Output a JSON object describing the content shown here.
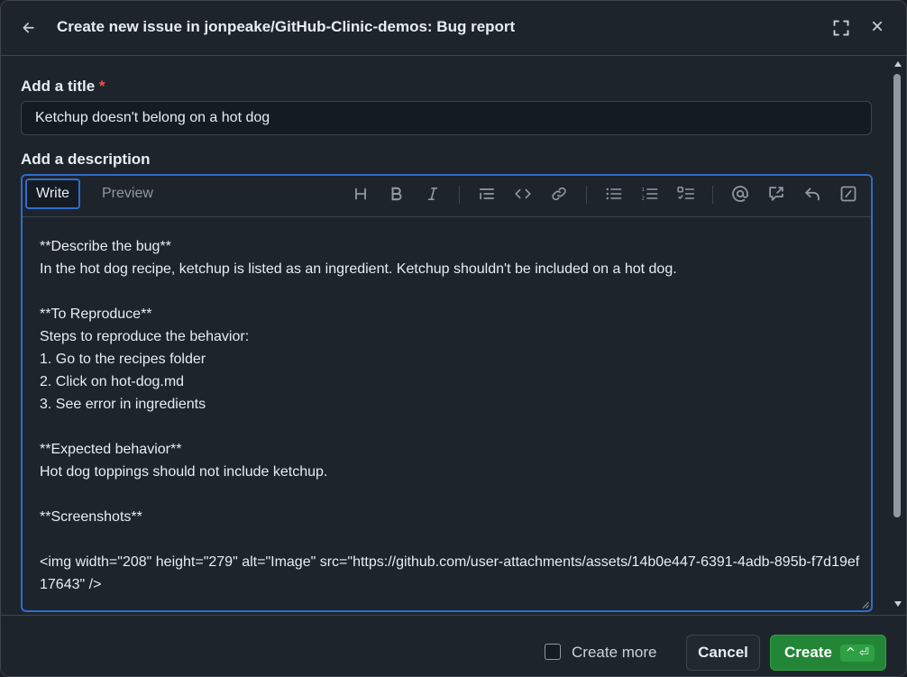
{
  "header": {
    "title": "Create new issue in jonpeake/GitHub-Clinic-demos: Bug report",
    "back_icon": "arrow-left-icon",
    "fullscreen_icon": "fullscreen-icon",
    "close_icon": "close-icon"
  },
  "form": {
    "title_label": "Add a title",
    "required_mark": "*",
    "title_value": "Ketchup doesn't belong on a hot dog",
    "description_label": "Add a description"
  },
  "editor": {
    "tabs": [
      {
        "label": "Write",
        "active": true
      },
      {
        "label": "Preview",
        "active": false
      }
    ],
    "toolbar_icons": [
      "heading-icon",
      "bold-icon",
      "italic-icon",
      "quote-icon",
      "code-icon",
      "link-icon",
      "bullet-list-icon",
      "numbered-list-icon",
      "task-list-icon",
      "mention-icon",
      "cross-reference-icon",
      "reply-icon",
      "slash-commands-icon"
    ],
    "body": "**Describe the bug**\nIn the hot dog recipe, ketchup is listed as an ingredient. Ketchup shouldn't be included on a hot dog.\n\n**To Reproduce**\nSteps to reproduce the behavior:\n1. Go to the recipes folder\n2. Click on hot-dog.md\n3. See error in ingredients\n\n**Expected behavior**\nHot dog toppings should not include ketchup.\n\n**Screenshots**\n\n<img width=\"208\" height=\"279\" alt=\"Image\" src=\"https://github.com/user-attachments/assets/14b0e447-6391-4adb-895b-f7d19ef17643\" />"
  },
  "footer": {
    "create_more_label": "Create more",
    "create_more_checked": false,
    "cancel_label": "Cancel",
    "create_label": "Create",
    "create_shortcut": "^ ⏎"
  },
  "colors": {
    "accent_blue": "#316dca",
    "create_green": "#238636",
    "required_red": "#f85149"
  }
}
